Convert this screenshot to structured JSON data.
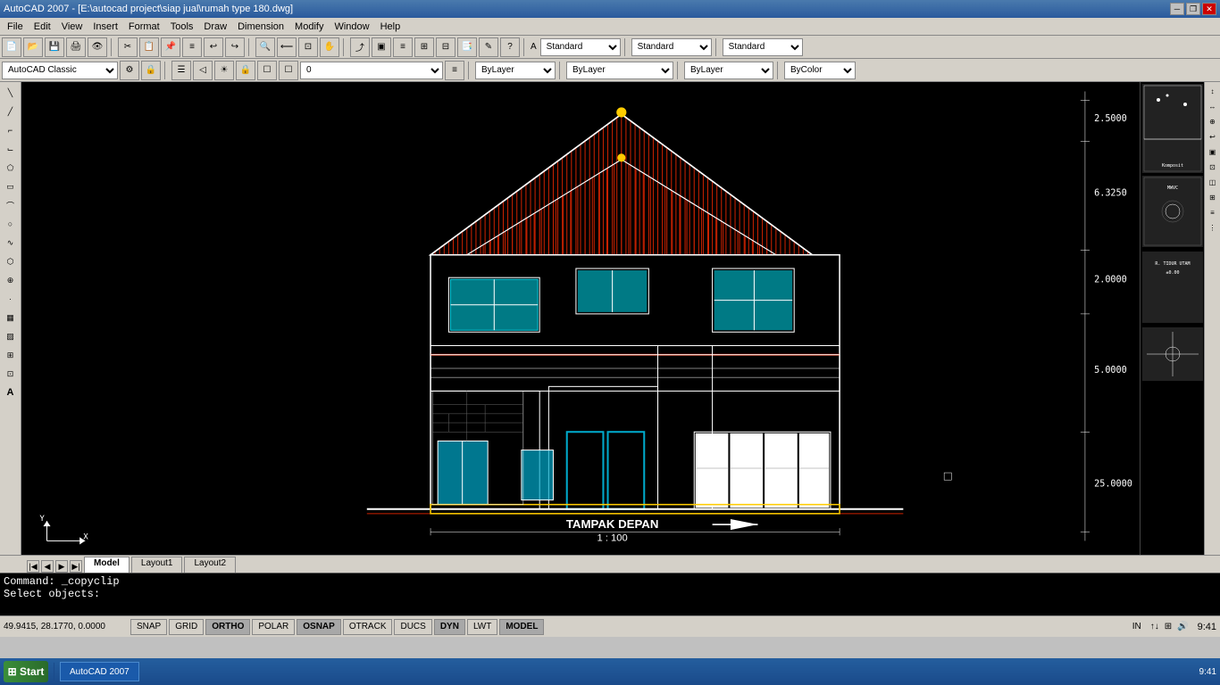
{
  "titlebar": {
    "text": "AutoCAD 2007 - [E:\\autocad project\\siap jual\\rumah type 180.dwg]",
    "minimize": "─",
    "restore": "❐",
    "close": "✕"
  },
  "menubar": {
    "items": [
      "File",
      "Edit",
      "View",
      "Insert",
      "Format",
      "Tools",
      "Draw",
      "Dimension",
      "Modify",
      "Window",
      "Help"
    ]
  },
  "toolbar1": {
    "combos": [
      "Standard",
      "Standard",
      "Standard"
    ]
  },
  "toolbar2": {
    "workspace": "AutoCAD Classic",
    "layer": "0",
    "color": "ByLayer",
    "linetype": "ByLayer",
    "lineweight": "ByLayer",
    "plotstyle": "ByColor"
  },
  "tabs": {
    "model": "Model",
    "layout1": "Layout1",
    "layout2": "Layout2"
  },
  "canvas": {
    "title": "TAMPAK DEPAN",
    "scale": "1 : 100"
  },
  "dimensions": {
    "top": "2.5000",
    "mid1": "6.3250",
    "mid2": "2.0000",
    "mid3": "5.0000",
    "mid4": "25.0000",
    "right_label": "R. TIDUR UTAM",
    "right_value": "±0.00"
  },
  "command_area": {
    "line1": "Command: _copyclip",
    "line2": "Select objects:"
  },
  "statusbar": {
    "coords": "49.9415, 28.1770, 0.0000",
    "buttons": [
      "SNAP",
      "GRID",
      "ORTHO",
      "POLAR",
      "OSNAP",
      "OTRACK",
      "DUCS",
      "DYN",
      "LWT",
      "MODEL"
    ]
  },
  "taskbar": {
    "time": "9:41",
    "start": "Start",
    "items": [
      "AutoCAD 2007"
    ]
  },
  "left_tools": [
    "╱",
    "↗",
    "▭",
    "○",
    "△",
    "⌇",
    "⌁",
    "∿",
    "↺",
    "⊕",
    "✎",
    "⊞",
    "⊡",
    "⊠",
    "A"
  ],
  "right_tools": [
    "↕",
    "↔",
    "⊕",
    "↩",
    "▣",
    "◫"
  ]
}
